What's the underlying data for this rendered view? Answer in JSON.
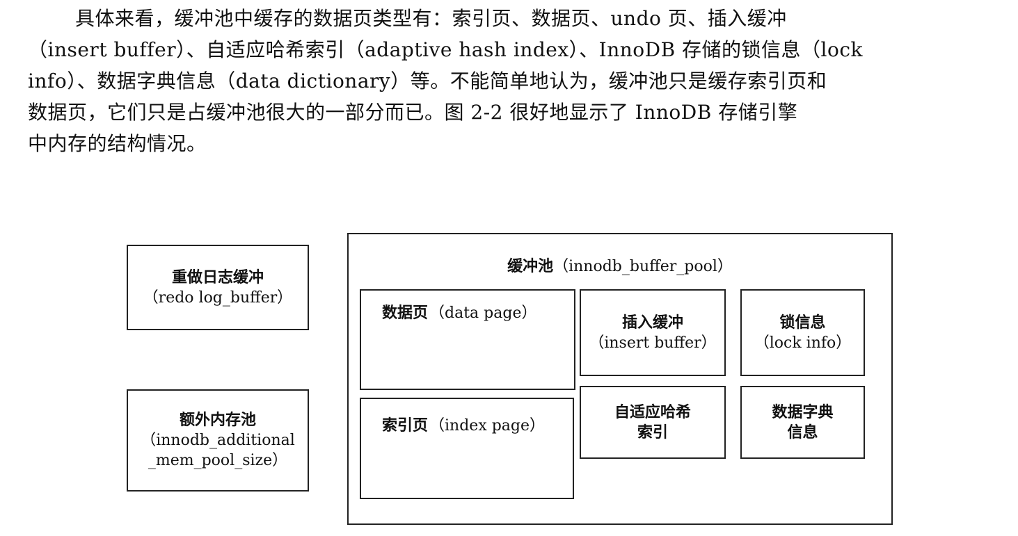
{
  "paragraph": {
    "lines": [
      "具体来看，缓冲池中缓存的数据页类型有：索引页、数据页、undo 页、插入缓冲",
      "（insert buffer）、自适应哈希索引（adaptive hash index）、InnoDB 存储的锁信息（lock",
      "info）、数据字典信息（data dictionary）等。不能简单地认为，缓冲池只是缓存索引页和",
      "数据页，它们只是占缓冲池很大的一部分而已。图 2-2 很好地显示了 InnoDB 存储引擎",
      "中内存的结构情况。"
    ]
  },
  "diagram": {
    "redo": {
      "title": "重做日志缓冲",
      "subtitle": "（redo log_buffer）"
    },
    "additional": {
      "title": "额外内存池",
      "subtitle_line1": "（innodb_additional",
      "subtitle_line2": "_mem_pool_size）"
    },
    "pool": {
      "title": "缓冲池",
      "subtitle": "（innodb_buffer_pool）"
    },
    "data_page": {
      "title": "数据页",
      "subtitle": "（data page）"
    },
    "index_page": {
      "title": "索引页",
      "subtitle": "（index page）"
    },
    "insert_buffer": {
      "title": "插入缓冲",
      "subtitle": "（insert buffer）"
    },
    "lock_info": {
      "title": "锁信息",
      "subtitle": "（lock info）"
    },
    "adaptive_hash": {
      "line1": "自适应哈希",
      "line2": "索引"
    },
    "data_dictionary": {
      "line1": "数据字典",
      "line2": "信息"
    }
  }
}
